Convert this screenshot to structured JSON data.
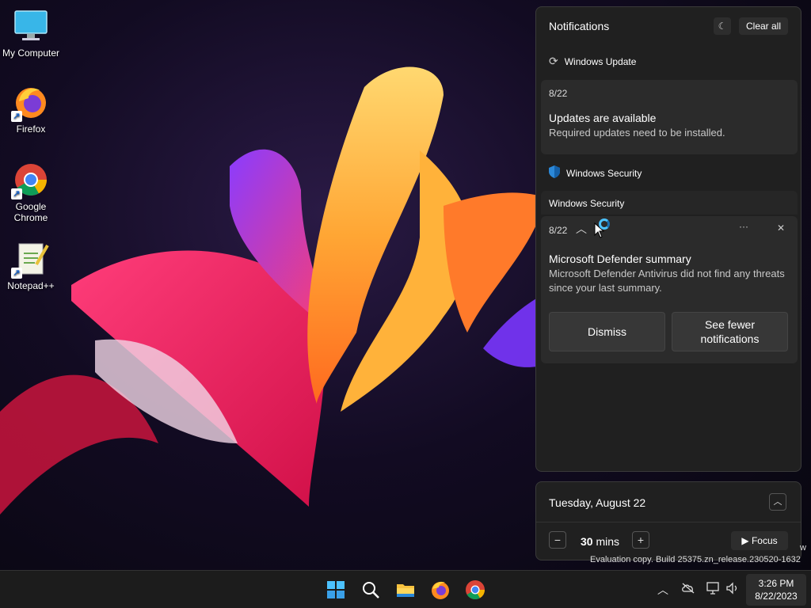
{
  "desktop": {
    "icons": [
      {
        "label": "My Computer",
        "icon": "monitor-icon"
      },
      {
        "label": "Firefox",
        "icon": "firefox-icon"
      },
      {
        "label": "Google Chrome",
        "icon": "chrome-icon"
      },
      {
        "label": "Notepad++",
        "icon": "notepadpp-icon"
      }
    ]
  },
  "notifications": {
    "header": "Notifications",
    "dnd_icon": "do-not-disturb-icon",
    "clear_all": "Clear all",
    "groups": [
      {
        "app": "Windows Update",
        "icon": "refresh-icon",
        "items": [
          {
            "date": "8/22",
            "title": "Updates are available",
            "body": "Required updates need to be installed."
          }
        ]
      },
      {
        "app": "Windows Security",
        "icon": "shield-icon",
        "subheader": "Windows Security",
        "items": [
          {
            "date": "8/22",
            "title": "Microsoft Defender summary",
            "body": "Microsoft Defender Antivirus did not find any threats since your last summary.",
            "more": "···",
            "close": "✕",
            "buttons": [
              "Dismiss",
              "See fewer notifications"
            ]
          }
        ]
      }
    ]
  },
  "calendar": {
    "date": "Tuesday, August 22",
    "focus": {
      "minus": "−",
      "duration": "30",
      "unit": "mins",
      "plus": "+",
      "button": "Focus",
      "button_icon": "play-icon"
    }
  },
  "watermark": {
    "line1": "w",
    "line2": "Evaluation copy. Build 25375.zn_release.230520-1632"
  },
  "taskbar": {
    "apps": [
      "start-icon",
      "search-icon",
      "file-explorer-icon",
      "firefox-icon",
      "chrome-icon"
    ],
    "tray": [
      "chevron-up-icon",
      "cloud-offline-icon",
      "network-icon",
      "volume-icon"
    ],
    "time": "3:26 PM",
    "date": "8/22/2023"
  },
  "colors": {
    "accent": "#4cc2ff",
    "panel": "#202020",
    "card": "#2b2b2b"
  }
}
